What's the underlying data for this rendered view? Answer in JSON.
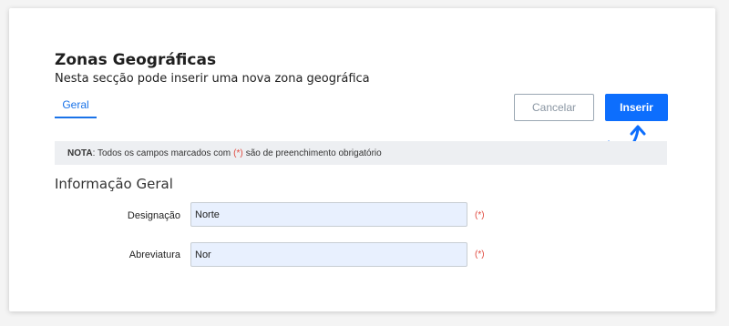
{
  "header": {
    "title": "Zonas Geográficas",
    "subtitle": "Nesta secção pode inserir uma nova zona geográfica"
  },
  "tabs": [
    {
      "label": "Geral",
      "active": true
    }
  ],
  "actions": {
    "cancel_label": "Cancelar",
    "insert_label": "Inserir"
  },
  "note": {
    "label": "NOTA",
    "text_before": ": Todos os campos marcados com",
    "required_marker": "(*)",
    "text_after": "são de preenchimento obrigatório"
  },
  "section": {
    "title": "Informação Geral"
  },
  "fields": [
    {
      "label": "Designação",
      "value": "Norte",
      "required_marker": "(*)"
    },
    {
      "label": "Abreviatura",
      "value": "Nor",
      "required_marker": "(*)"
    }
  ],
  "colors": {
    "accent": "#0d6efd",
    "required": "#e04a3f",
    "input_bg": "#e8f0fe"
  }
}
